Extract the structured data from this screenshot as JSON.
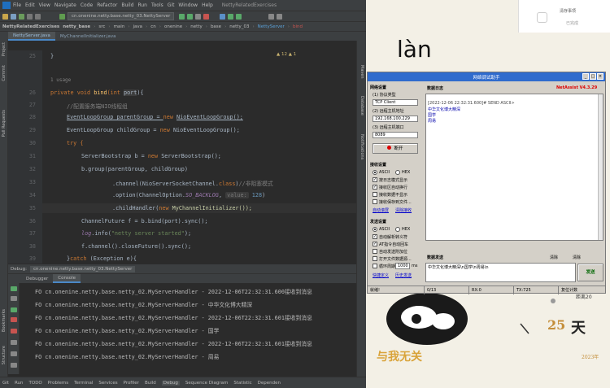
{
  "ide": {
    "menu": [
      "File",
      "Edit",
      "View",
      "Navigate",
      "Code",
      "Refactor",
      "Build",
      "Run",
      "Tools",
      "Git",
      "Window",
      "Help"
    ],
    "window_title": "NettyRelatedExercises",
    "run_config": "cn.onenine.netty.base.netty_03.NettyServer",
    "breadcrumb": [
      "NettyRelatedExercises",
      "netty_base",
      "src",
      "main",
      "java",
      "cn",
      "onenine",
      "netty",
      "base",
      "netty_03",
      "NettyServer",
      "bind"
    ],
    "tabs": [
      "NettyServer.java",
      "MyChannelInitializer.java"
    ],
    "inspections": "▲ 12  ▲ 1",
    "usages": "1 usage",
    "line_numbers": [
      "25",
      "26",
      "27",
      "28",
      "29",
      "30",
      "31",
      "32",
      "33",
      "34",
      "35",
      "36",
      "37",
      "38",
      "39"
    ],
    "code": {
      "l25": "}",
      "l26_kw": "private void ",
      "l26_fn": "bind",
      "l26_rest": "(int ",
      "l26_param": "port",
      "l26_end": "){",
      "l27": "//配置服务端NIO线程组",
      "l28_a": "EventLoopGroup parentGroup = ",
      "l28_kw": "new ",
      "l28_b": "NioEventLoopGroup();",
      "l29_a": "EventLoopGroup childGroup = ",
      "l29_kw": "new ",
      "l29_b": "NioEventLoopGroup();",
      "l30": "try {",
      "l31_a": "ServerBootstrap b = ",
      "l31_kw": "new ",
      "l31_b": "ServerBootstrap();",
      "l32": "b.group(parentGroup, childGroup)",
      "l33_a": ".channel(NioServerSocketChannel.",
      "l33_kw": "class",
      "l33_b": ")",
      "l33_cm": "//非阻塞模式",
      "l34_a": ".option(ChannelOption.",
      "l34_fld": "SO_BACKLOG",
      "l34_hint": "value:",
      "l34_num": "128",
      "l34_b": ")",
      "l35_a": ".childHandler(",
      "l35_kw": "new ",
      "l35_b": "MyChannelInitializer());",
      "l36_a": "ChannelFuture f = b.bind(port).sync();",
      "l37_a": "log",
      "l37_b": ".info(",
      "l37_str": "\"netty server started\"",
      "l37_c": ");",
      "l38": "f.channel().closeFuture().sync();",
      "l39_a": "}",
      "l39_kw": "catch ",
      "l39_b": "(Exception e){"
    },
    "debug": {
      "title": "Debug:",
      "config": "cn.onenine.netty.base.netty_03.NettyServer",
      "tabs": [
        "Debugger",
        "Console"
      ],
      "log": [
        "FO cn.onenine.netty.base.netty_02.MyServerHandler - 2022-12-06T22:32:31.600接收到消息",
        "FO cn.onenine.netty.base.netty_02.MyServerHandler - 中华文化博大精深",
        "FO cn.onenine.netty.base.netty_02.MyServerHandler - 2022-12-06T22:32:31.601接收到消息",
        "FO cn.onenine.netty.base.netty_02.MyServerHandler - 国学",
        "FO cn.onenine.netty.base.netty_02.MyServerHandler - 2022-12-06T22:32:31.601接收到消息",
        "FO cn.onenine.netty.base.netty_02.MyServerHandler - 周易"
      ]
    },
    "statusbar": [
      "Git",
      "Run",
      "TODO",
      "Problems",
      "Terminal",
      "Services",
      "Profiler",
      "Build",
      "Debug",
      "Sequence Diagram",
      "Statistic",
      "Dependen"
    ],
    "side_left": [
      "Project",
      "Commit",
      "Pull Requests",
      "Bookmarks",
      "Structure"
    ],
    "side_right": [
      "Maven",
      "Database",
      "Notifications"
    ]
  },
  "assistant": {
    "title": "网络调试助手",
    "version": "NetAssist V4.3.29",
    "net_settings": "网络设置",
    "protocol_label": "(1) 协议类型",
    "protocol": "TCP Client",
    "host_label": "(2) 远程主机地址",
    "host": "192.168.100.229",
    "port_label": "(3) 远程主机端口",
    "port": "8089",
    "open_btn": "断开",
    "recv_settings": "接收设置",
    "recv_opts": [
      "ASCII",
      "HEX"
    ],
    "recv_checks": [
      {
        "label": "按日志模式显示",
        "checked": true
      },
      {
        "label": "接收区自动换行",
        "checked": true
      },
      {
        "label": "接收数据不显示",
        "checked": false
      },
      {
        "label": "接收保存到文件...",
        "checked": false
      }
    ],
    "recv_links": [
      "自动滚屏",
      "清除接收"
    ],
    "send_settings": "发送设置",
    "send_opts": [
      "ASCII",
      "HEX"
    ],
    "send_checks": [
      {
        "label": "自动解析转义符",
        "checked": true
      },
      {
        "label": "AT指令自动回车",
        "checked": true
      },
      {
        "label": "自动发送附加位",
        "checked": false
      },
      {
        "label": "打开文件数据源...",
        "checked": false
      },
      {
        "label": "循环周期",
        "checked": false
      }
    ],
    "loop_ms": "1000",
    "loop_unit": "ms",
    "send_links": [
      "快捷定义",
      "历史发送"
    ],
    "recv_header": "数据日志",
    "recv_log_head": "[2022-12-06 22:32:31.600]# SEND ASCII>",
    "recv_lines": [
      "中华文化博大精深",
      "国学",
      "周易"
    ],
    "send_header": "数据发送",
    "send_btns": [
      "清除",
      "清除"
    ],
    "send_text": "中华文化博大精深\\n国学\\n周易\\n",
    "send_btn": "发送",
    "status": {
      "ready": "就绪!",
      "send": "0/13",
      "rx": "RX:0",
      "tx": "TX:725",
      "reset": "复位计数"
    }
  },
  "background": {
    "pinyin": "làn",
    "chat_snippet": "清存事项",
    "chat_sub": "已完成",
    "slogan": "与我无关",
    "days_num": "25",
    "days_cn": "天",
    "year": "2023年",
    "corner_text": "距离20"
  },
  "colors": {
    "accent": "#4a88c7",
    "ide_bg": "#2b2b2b",
    "panel": "#3c3f41",
    "assistant_title": "#2f6bcd"
  }
}
